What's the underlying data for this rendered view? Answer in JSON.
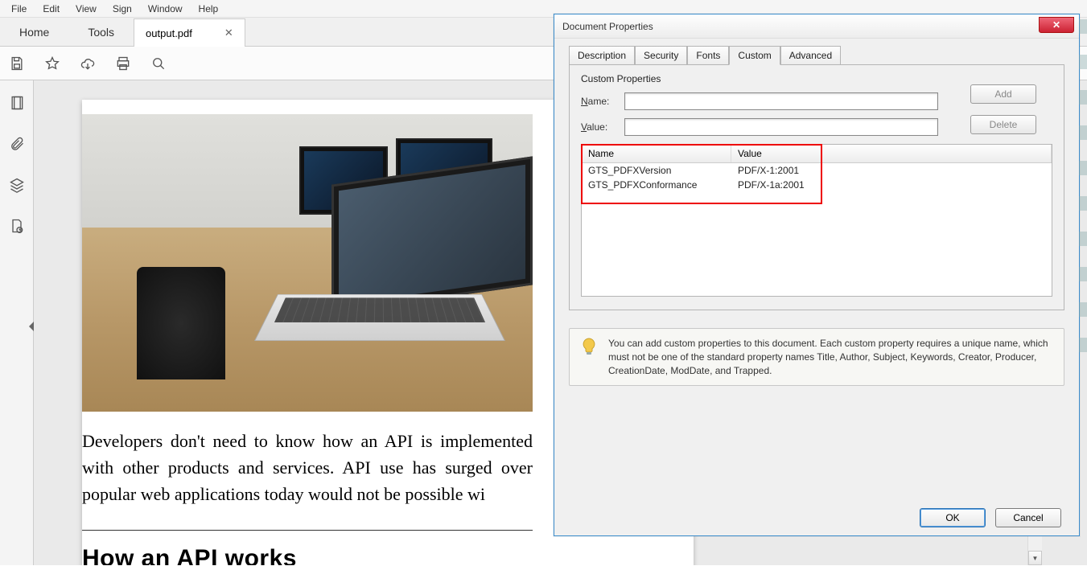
{
  "menu": {
    "file": "File",
    "edit": "Edit",
    "view": "View",
    "sign": "Sign",
    "window": "Window",
    "help": "Help"
  },
  "mainTabs": {
    "home": "Home",
    "tools": "Tools"
  },
  "doc": {
    "title": "output.pdf"
  },
  "article": {
    "paragraph": "Developers don't need to know how an API is implemented with other products and services. API use has surged over popular web applications today would not be possible wi",
    "heading": "How an API works"
  },
  "dialog": {
    "title": "Document Properties",
    "tabs": {
      "description": "Description",
      "security": "Security",
      "fonts": "Fonts",
      "custom": "Custom",
      "advanced": "Advanced"
    },
    "group": "Custom Properties",
    "nameLabel": "Name:",
    "valueLabel": "Value:",
    "nameField": "",
    "valueField": "",
    "addBtn": "Add",
    "deleteBtn": "Delete",
    "table": {
      "headName": "Name",
      "headValue": "Value",
      "rows": [
        {
          "name": "GTS_PDFXVersion",
          "value": "PDF/X-1:2001"
        },
        {
          "name": "GTS_PDFXConformance",
          "value": "PDF/X-1a:2001"
        }
      ]
    },
    "info": "You can add custom properties to this document. Each custom property requires a unique name, which must not be one of the standard property names Title, Author, Subject, Keywords, Creator, Producer, CreationDate, ModDate, and Trapped.",
    "okBtn": "OK",
    "cancelBtn": "Cancel"
  }
}
